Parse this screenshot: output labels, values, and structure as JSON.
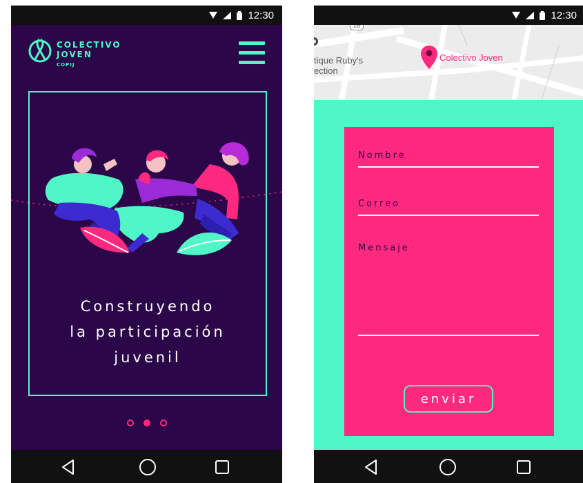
{
  "status_bar": {
    "time": "12:30"
  },
  "left_screen": {
    "brand": {
      "line1": "COLECTIVO",
      "line2": "JOVEN",
      "sub": "COPIJ"
    },
    "hero": {
      "line1": "Construyendo",
      "line2": "la participación",
      "line3": "juvenil"
    },
    "carousel": {
      "count": 3,
      "active_index": 1
    }
  },
  "right_screen": {
    "map": {
      "place_label_line1": "tique Ruby's",
      "place_label_line2": "ection",
      "pin_label": "Colectivo Joven",
      "road_badge": "16"
    },
    "form": {
      "name_label": "Nombre",
      "email_label": "Correo",
      "message_label": "Mensaje",
      "submit_label": "enviar"
    }
  },
  "colors": {
    "background_dark": "#2b0648",
    "accent_teal": "#4ff7c6",
    "accent_pink": "#ff2a7f"
  },
  "icons": {
    "nav": [
      "back-triangle-icon",
      "home-circle-icon",
      "recents-square-icon"
    ],
    "status": [
      "wifi-icon",
      "signal-icon",
      "battery-icon"
    ]
  }
}
